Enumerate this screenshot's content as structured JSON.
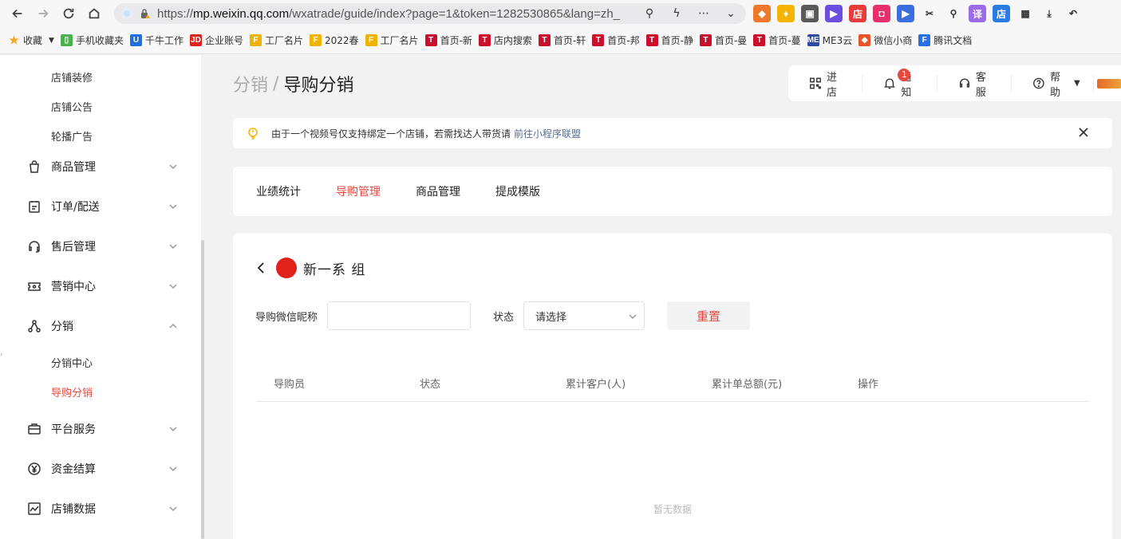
{
  "browser": {
    "url_prefix": "https://",
    "url_host": "mp.weixin.qq.com",
    "url_path": "/wxatrade/guide/index?page=1&token=1282530865&lang=zh_",
    "extensions": [
      {
        "name": "game-ext-icon",
        "color": "#f0782a",
        "glyph": "◆"
      },
      {
        "name": "shield-ext-icon",
        "color": "#f5b400",
        "glyph": "♦"
      },
      {
        "name": "book-ext-icon",
        "color": "#5a5a5a",
        "glyph": "▣"
      },
      {
        "name": "video-ext-icon",
        "color": "#6b4fe0",
        "glyph": "▶"
      },
      {
        "name": "shop-ext-icon",
        "color": "#e83b3b",
        "glyph": "店"
      },
      {
        "name": "bag-ext-icon",
        "color": "#e8306a",
        "glyph": "◘"
      },
      {
        "name": "play-ext-icon",
        "color": "#3b6fe0",
        "glyph": "▶"
      },
      {
        "name": "scissors-ext-icon",
        "color": "#ffffff",
        "glyph": "✂"
      },
      {
        "name": "search-ext-icon",
        "color": "#ffffff",
        "glyph": "⚲"
      },
      {
        "name": "translate-ext-icon",
        "color": "#9b6be8",
        "glyph": "译"
      },
      {
        "name": "store-ext-icon",
        "color": "#2b7be5",
        "glyph": "店"
      },
      {
        "name": "grid-ext-icon",
        "color": "#ffffff",
        "glyph": "▦"
      },
      {
        "name": "download-ext-icon",
        "color": "#ffffff",
        "glyph": "⤓"
      },
      {
        "name": "undo-ext-icon",
        "color": "#ffffff",
        "glyph": "↶"
      }
    ],
    "bookmarks": [
      {
        "label": "收藏",
        "icon": "star-icon",
        "color": "#f5a623",
        "glyph": "★"
      },
      {
        "label": "手机收藏夹",
        "icon": "phone-icon",
        "color": "#4caf50",
        "glyph": "▯"
      },
      {
        "label": "千牛工作",
        "icon": "qianniu-icon",
        "color": "#1e6fe0",
        "glyph": "U"
      },
      {
        "label": "企业账号",
        "icon": "jd-icon",
        "color": "#d9251c",
        "glyph": "JD"
      },
      {
        "label": "工厂名片",
        "icon": "factory-icon",
        "color": "#f0b400",
        "glyph": "F"
      },
      {
        "label": "2022春",
        "icon": "factory-icon",
        "color": "#f0b400",
        "glyph": "F"
      },
      {
        "label": "工厂名片",
        "icon": "factory-icon",
        "color": "#f0b400",
        "glyph": "F"
      },
      {
        "label": "首页-新",
        "icon": "tmall-icon",
        "color": "#c8102e",
        "glyph": "T"
      },
      {
        "label": "店内搜索",
        "icon": "tmall-icon",
        "color": "#c8102e",
        "glyph": "T"
      },
      {
        "label": "首页-轩",
        "icon": "tmall-icon",
        "color": "#c8102e",
        "glyph": "T"
      },
      {
        "label": "首页-邦",
        "icon": "tmall-icon",
        "color": "#c8102e",
        "glyph": "T"
      },
      {
        "label": "首页-静",
        "icon": "tmall-icon",
        "color": "#c8102e",
        "glyph": "T"
      },
      {
        "label": "首页-曼",
        "icon": "tmall-icon",
        "color": "#c8102e",
        "glyph": "T"
      },
      {
        "label": "首页-蔓",
        "icon": "tmall-icon",
        "color": "#c8102e",
        "glyph": "T"
      },
      {
        "label": "ME3云",
        "icon": "me3-icon",
        "color": "#2f4a9e",
        "glyph": "ME"
      },
      {
        "label": "微信小商",
        "icon": "wechat-shop-icon",
        "color": "#e8552b",
        "glyph": "◆"
      },
      {
        "label": "腾讯文档",
        "icon": "tencent-doc-icon",
        "color": "#2b6fe5",
        "glyph": "F"
      }
    ]
  },
  "sidebar": {
    "top_subitems": [
      "店铺装修",
      "店铺公告",
      "轮播广告"
    ],
    "menu": [
      {
        "label": "商品管理",
        "icon": "bag-icon"
      },
      {
        "label": "订单/配送",
        "icon": "clipboard-icon"
      },
      {
        "label": "售后管理",
        "icon": "headset-icon"
      },
      {
        "label": "营销中心",
        "icon": "ticket-icon"
      },
      {
        "label": "分销",
        "icon": "share-icon"
      },
      {
        "label": "平台服务",
        "icon": "briefcase-icon"
      },
      {
        "label": "资金结算",
        "icon": "yen-icon"
      },
      {
        "label": "店铺数据",
        "icon": "chart-icon"
      }
    ],
    "distribution_subitems": [
      "分销中心",
      "导购分销"
    ]
  },
  "header": {
    "breadcrumb_parent": "分销",
    "breadcrumb_sep": "/",
    "breadcrumb_current": "导购分销",
    "enter_store": "进店",
    "notice": "通知",
    "notice_count": "1",
    "service": "客服",
    "help": "帮助"
  },
  "notice_bar": {
    "text": "由于一个视频号仅支持绑定一个店铺，若需找达人带货请",
    "link": "前往小程序联盟"
  },
  "tabs": [
    "业绩统计",
    "导购管理",
    "商品管理",
    "提成模版"
  ],
  "group": {
    "name": "新一系 组"
  },
  "filters": {
    "nickname_label": "导购微信昵称",
    "nickname_value": "",
    "status_label": "状态",
    "status_placeholder": "请选择",
    "reset_label": "重置"
  },
  "table": {
    "columns": [
      "导购员",
      "状态",
      "累计客户(人)",
      "累计单总额(元)",
      "操作"
    ],
    "empty_text": "暂无数据"
  },
  "colors": {
    "accent": "#e5493f",
    "link": "#576b95"
  }
}
